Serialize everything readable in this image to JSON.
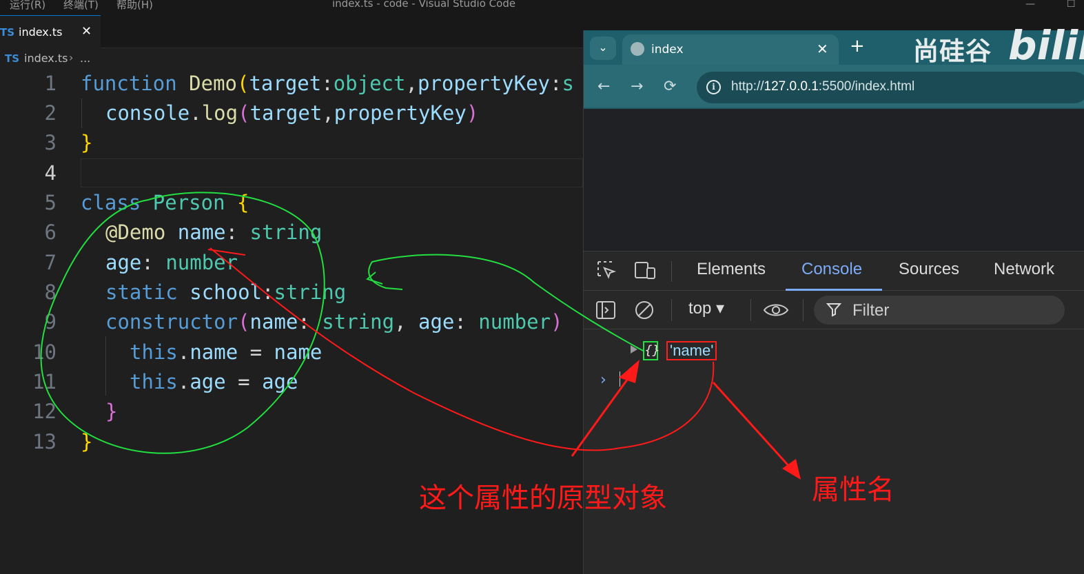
{
  "menubar": {
    "items": [
      "运行(R)",
      "终端(T)",
      "帮助(H)"
    ],
    "window_title": "index.ts - code - Visual Studio Code"
  },
  "editor_tab": {
    "badge": "TS",
    "label": "index.ts",
    "close": "✕"
  },
  "breadcrumb": {
    "badge": "TS",
    "file": "index.ts",
    "separator": "›",
    "more": "..."
  },
  "code": {
    "line_numbers": [
      "1",
      "2",
      "3",
      "4",
      "5",
      "6",
      "7",
      "8",
      "9",
      "10",
      "11",
      "12",
      "13"
    ],
    "active_line": "4",
    "tokens": {
      "function": "function",
      "Demo": "Demo",
      "target": "target",
      "object": "object",
      "propertyKey": "propertyKey",
      "string_cut": "s",
      "console": "console",
      "log": "log",
      "class": "class",
      "Person": "Person",
      "decorator": "@Demo",
      "name": "name",
      "string": "string",
      "age": "age",
      "number": "number",
      "static": "static",
      "school": "school",
      "constructor": "constructor",
      "this": "this"
    }
  },
  "browser": {
    "tab_title": "index",
    "tab_close": "✕",
    "new_tab": "+",
    "url_prefix": "http://",
    "url_host": "127.0.0.1",
    "url_rest": ":5500/index.html",
    "watermark": "尚硅谷",
    "watermark_logo": "bilib"
  },
  "devtools": {
    "tabs": [
      "Elements",
      "Console",
      "Sources",
      "Network"
    ],
    "active_tab": "Console",
    "context": "top ▾",
    "filter_placeholder": "Filter",
    "log_object": "{}",
    "log_string": "'name'",
    "prompt": "›"
  },
  "annotations": {
    "prototype_label": "这个属性的原型对象",
    "property_name_label": "属性名",
    "colors": {
      "green": "#22e040",
      "red": "#ff1a1a"
    }
  }
}
